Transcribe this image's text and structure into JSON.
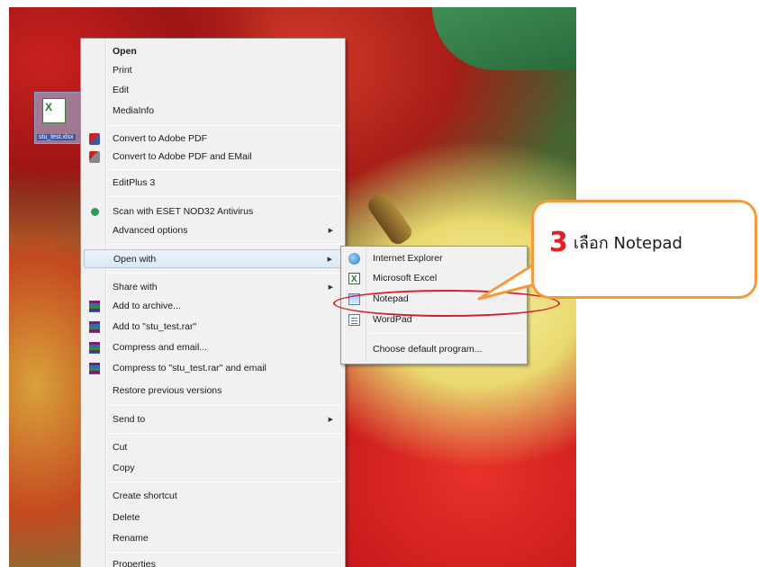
{
  "desktop": {
    "file_caption": "stu_test.xlsx"
  },
  "context_menu": {
    "items": [
      {
        "label": "Open",
        "bold": true
      },
      {
        "label": "Print"
      },
      {
        "label": "Edit"
      },
      {
        "label": "MediaInfo"
      },
      {
        "label": "Convert to Adobe PDF",
        "icon": "adobe-pdf-icon"
      },
      {
        "label": "Convert to Adobe PDF and EMail",
        "icon": "adobe-pdf-email-icon"
      },
      {
        "label": "EditPlus 3"
      },
      {
        "label": "Scan with ESET NOD32 Antivirus",
        "icon": "eset-icon"
      },
      {
        "label": "Advanced options",
        "submenu": true
      },
      {
        "label": "Open with",
        "submenu": true,
        "highlighted": true
      },
      {
        "label": "Share with",
        "submenu": true
      },
      {
        "label": "Add to archive...",
        "icon": "winrar-icon"
      },
      {
        "label": "Add to \"stu_test.rar\"",
        "icon": "winrar-icon"
      },
      {
        "label": "Compress and email...",
        "icon": "winrar-icon"
      },
      {
        "label": "Compress to \"stu_test.rar\" and email",
        "icon": "winrar-icon"
      },
      {
        "label": "Restore previous versions"
      },
      {
        "label": "Send to",
        "submenu": true
      },
      {
        "label": "Cut"
      },
      {
        "label": "Copy"
      },
      {
        "label": "Create shortcut"
      },
      {
        "label": "Delete"
      },
      {
        "label": "Rename"
      },
      {
        "label": "Properties"
      }
    ]
  },
  "open_with_submenu": {
    "items": [
      {
        "label": "Internet Explorer",
        "icon": "internet-explorer-icon"
      },
      {
        "label": "Microsoft Excel",
        "icon": "excel-icon"
      },
      {
        "label": "Notepad",
        "icon": "notepad-icon"
      },
      {
        "label": "WordPad",
        "icon": "wordpad-icon"
      },
      {
        "label": "Choose default program..."
      }
    ]
  },
  "callout": {
    "step_number": "3",
    "text": "เลือก Notepad",
    "border_color": "#f59a3c",
    "number_color": "#e01f26"
  },
  "highlight_color": "#d61f2a"
}
